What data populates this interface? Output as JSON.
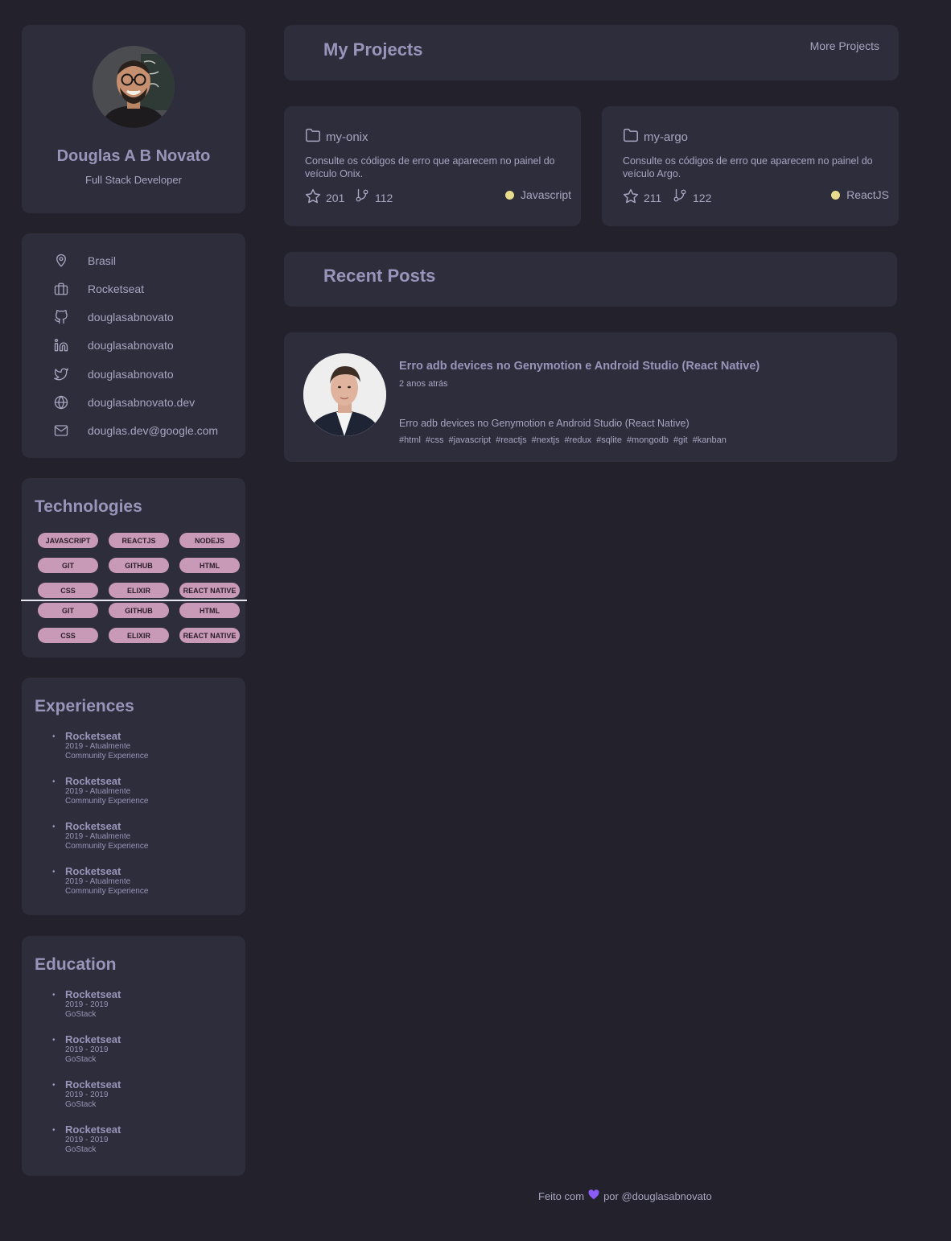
{
  "profile": {
    "name": "Douglas A B Novato",
    "role": "Full Stack Developer"
  },
  "contacts": [
    {
      "icon": "map-pin-icon",
      "label": "Brasil"
    },
    {
      "icon": "briefcase-icon",
      "label": "Rocketseat"
    },
    {
      "icon": "github-icon",
      "label": "douglasabnovato"
    },
    {
      "icon": "linkedin-icon",
      "label": "douglasabnovato"
    },
    {
      "icon": "twitter-icon",
      "label": "douglasabnovato"
    },
    {
      "icon": "globe-icon",
      "label": "douglasabnovato.dev"
    },
    {
      "icon": "mail-icon",
      "label": "douglas.dev@google.com"
    }
  ],
  "technologies": {
    "title": "Technologies",
    "tags": [
      "JAVASCRIPT",
      "REACTJS",
      "NODEJS",
      "GIT",
      "GITHUB",
      "HTML",
      "CSS",
      "ELIXIR",
      "REACT NATIVE",
      "GIT",
      "GITHUB",
      "HTML",
      "CSS",
      "ELIXIR",
      "REACT NATIVE"
    ]
  },
  "experiences": {
    "title": "Experiences",
    "items": [
      {
        "org": "Rocketseat",
        "period": "2019 - Atualmente",
        "desc": "Community Experience"
      },
      {
        "org": "Rocketseat",
        "period": "2019 - Atualmente",
        "desc": "Community Experience"
      },
      {
        "org": "Rocketseat",
        "period": "2019 - Atualmente",
        "desc": "Community Experience"
      },
      {
        "org": "Rocketseat",
        "period": "2019 - Atualmente",
        "desc": "Community Experience"
      }
    ]
  },
  "education": {
    "title": "Education",
    "items": [
      {
        "org": "Rocketseat",
        "period": "2019 - 2019",
        "desc": "GoStack"
      },
      {
        "org": "Rocketseat",
        "period": "2019 - 2019",
        "desc": "GoStack"
      },
      {
        "org": "Rocketseat",
        "period": "2019 - 2019",
        "desc": "GoStack"
      },
      {
        "org": "Rocketseat",
        "period": "2019 - 2019",
        "desc": "GoStack"
      }
    ]
  },
  "projects": {
    "title": "My Projects",
    "more_label": "More Projects",
    "repos": [
      {
        "name": "my-onix",
        "description": "Consulte os códigos de erro que aparecem no painel do veículo Onix.",
        "stars": "201",
        "forks": "112",
        "language": "Javascript",
        "language_color": "#e8dc8c"
      },
      {
        "name": "my-argo",
        "description": "Consulte os códigos de erro que aparecem no painel do veículo Argo.",
        "stars": "211",
        "forks": "122",
        "language": "ReactJS",
        "language_color": "#e8dc8c"
      }
    ]
  },
  "posts": {
    "title": "Recent Posts",
    "items": [
      {
        "title": "Erro adb devices no Genymotion e Android Studio (React Native)",
        "time": "2 anos atrás",
        "excerpt": "Erro adb devices no Genymotion e Android Studio (React Native)",
        "tags": [
          "#html",
          "#css",
          "#javascript",
          "#reactjs",
          "#nextjs",
          "#redux",
          "#sqlite",
          "#mongodb",
          "#git",
          "#kanban"
        ]
      }
    ]
  },
  "footer": {
    "prefix": "Feito com",
    "suffix": "por @douglasabnovato",
    "heart_color": "#8b5cf6"
  },
  "colors": {
    "background": "#22212c",
    "card": "#2e2d3c",
    "accent_text": "#9994b9",
    "tag_bg": "#c89ab8"
  }
}
